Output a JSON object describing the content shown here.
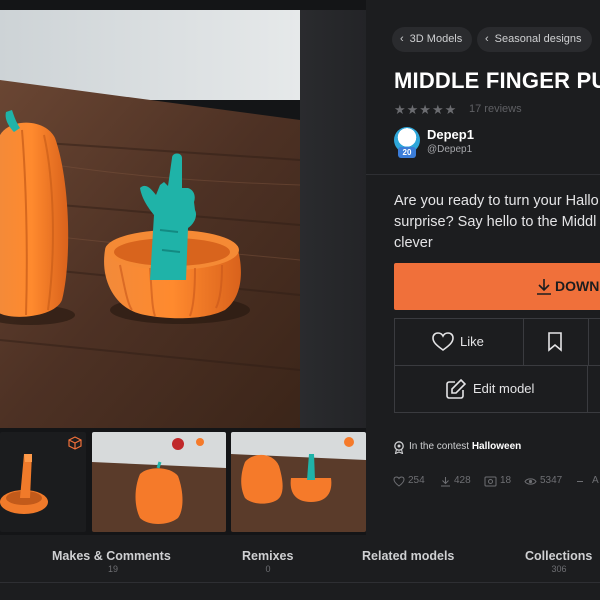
{
  "breadcrumbs": [
    {
      "label": "3D Models"
    },
    {
      "label": "Seasonal designs"
    }
  ],
  "model": {
    "title": "MIDDLE FINGER PU",
    "rating_stars": "★★★★★",
    "reviews": "17 reviews",
    "description_lines": [
      "Are you ready to turn your Hallo",
      "surprise? Say hello to the Middl",
      "clever"
    ]
  },
  "author": {
    "name": "Depep1",
    "handle": "@Depep1",
    "level_badge": "20"
  },
  "actions": {
    "download_label": "DOWN",
    "like_label": "Like",
    "edit_label": "Edit model"
  },
  "contest": {
    "prefix": "In the contest",
    "name": "Halloween"
  },
  "stats": {
    "likes": "254",
    "downloads": "428",
    "makes": "18",
    "views": "5347",
    "more": "A"
  },
  "tabs": [
    {
      "label": "Makes & Comments",
      "count": "19"
    },
    {
      "label": "Remixes",
      "count": "0"
    },
    {
      "label": "Related models",
      "count": ""
    },
    {
      "label": "Collections",
      "count": "306"
    }
  ],
  "colors": {
    "accent": "#f0703a",
    "background": "#1c1d1f",
    "pumpkin": "#f57a2a",
    "teal": "#1fb3a8"
  },
  "icons": [
    "chevron-left-icon",
    "star-icon",
    "download-icon",
    "heart-icon",
    "bookmark-icon",
    "edit-icon",
    "cube-icon",
    "trophy-icon",
    "like-stat-icon",
    "download-stat-icon",
    "makes-stat-icon",
    "views-stat-icon"
  ]
}
